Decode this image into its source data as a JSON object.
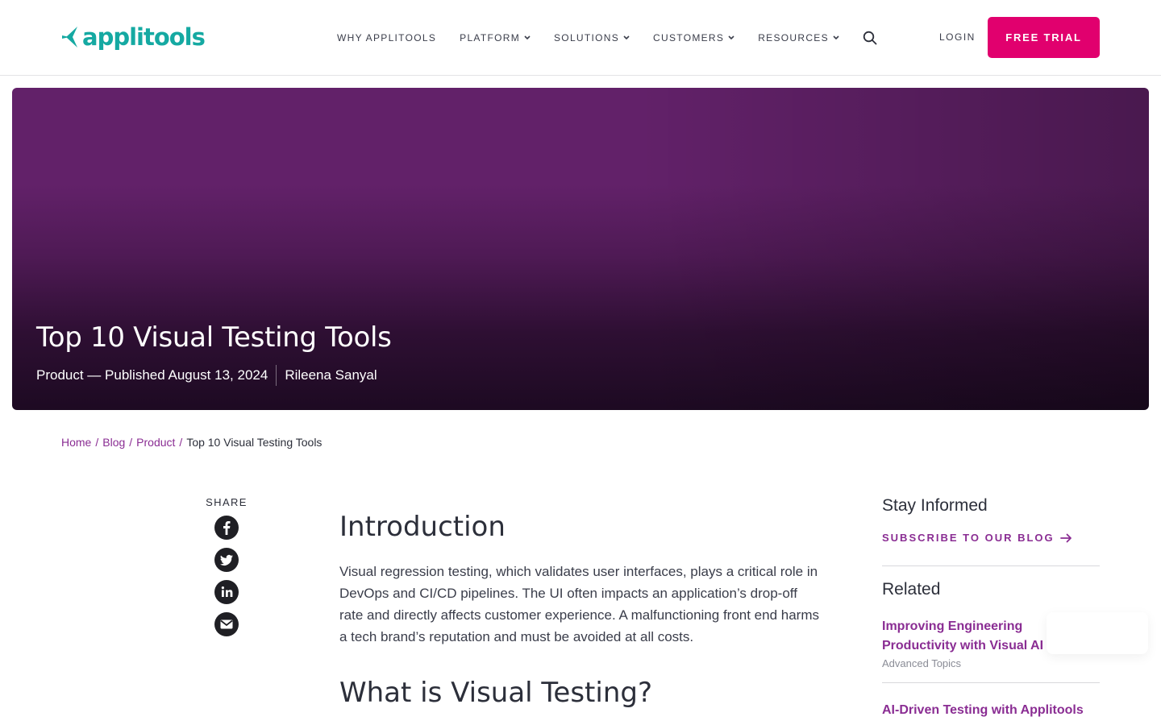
{
  "header": {
    "logo_text": "applitools",
    "nav": [
      {
        "label": "WHY APPLITOOLS",
        "has_dropdown": false
      },
      {
        "label": "PLATFORM",
        "has_dropdown": true
      },
      {
        "label": "SOLUTIONS",
        "has_dropdown": true
      },
      {
        "label": "CUSTOMERS",
        "has_dropdown": true
      },
      {
        "label": "RESOURCES",
        "has_dropdown": true
      }
    ],
    "search_icon": "search-icon",
    "login_label": "LOGIN",
    "trial_label": "FREE TRIAL"
  },
  "hero": {
    "title": "Top 10 Visual Testing Tools",
    "meta": "Product — Published August 13, 2024",
    "author": "Rileena Sanyal"
  },
  "breadcrumb": {
    "items": [
      "Home",
      "Blog",
      "Product"
    ],
    "current": "Top 10 Visual Testing Tools"
  },
  "share": {
    "label": "SHARE",
    "icons": [
      "facebook-icon",
      "twitter-icon",
      "linkedin-icon",
      "email-icon"
    ]
  },
  "article": {
    "heading1": "Introduction",
    "paragraph1": "Visual regression testing, which validates user interfaces, plays a critical role in DevOps and CI/CD pipelines. The UI often impacts an application’s drop-off rate and directly affects customer experience. A malfunctioning front end harms a tech brand’s reputation and must be avoided at all costs.",
    "heading2": "What is Visual Testing?"
  },
  "sidebar": {
    "stay_heading": "Stay Informed",
    "subscribe_label": "SUBSCRIBE TO OUR BLOG",
    "related_heading": "Related",
    "related": [
      {
        "title": "Improving Engineering Productivity with Visual AI",
        "category": "Advanced Topics"
      },
      {
        "title": "AI-Driven Testing with Applitools",
        "category": ""
      }
    ]
  },
  "colors": {
    "brand_teal": "#15a9a2",
    "cta_pink": "#e1006e",
    "link_purple": "#8a2d93",
    "hero_purple": "#622169"
  }
}
